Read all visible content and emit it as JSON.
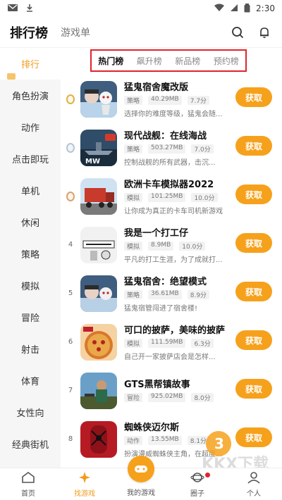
{
  "statusbar": {
    "time": "2:30"
  },
  "header": {
    "title": "排行榜",
    "subtab": "游戏单"
  },
  "sidebar": {
    "items": [
      "排行",
      "角色扮演",
      "动作",
      "点击即玩",
      "单机",
      "休闲",
      "策略",
      "模拟",
      "冒险",
      "射击",
      "体育",
      "女性向",
      "经典街机"
    ]
  },
  "rank_tabs": [
    "热门榜",
    "飙升榜",
    "新品榜",
    "预约榜"
  ],
  "get_label": "获取",
  "apps": [
    {
      "rank": "1",
      "name": "猛鬼宿舍魔改版",
      "meta": [
        "策略",
        "40.29MB",
        "7.7分"
      ],
      "desc": "选择你的难度等级，猛鬼会随..."
    },
    {
      "rank": "2",
      "name": "现代战舰：在线海战",
      "meta": [
        "策略",
        "503.27MB",
        "7.0分"
      ],
      "desc": "控制战舰的所有武器，击沉..."
    },
    {
      "rank": "3",
      "name": "欧洲卡车模拟器2022",
      "meta": [
        "模拟",
        "101.25MB",
        "10.0分"
      ],
      "desc": "让你成为真正的卡车司机新游戏"
    },
    {
      "rank": "4",
      "name": "我是一个打工仔",
      "meta": [
        "模拟",
        "8.9MB",
        "10.0分"
      ],
      "desc": "平凡的打工生涯，为了成就打..."
    },
    {
      "rank": "5",
      "name": "猛鬼宿舍：绝望模式",
      "meta": [
        "策略",
        "36.61MB",
        "8.9分"
      ],
      "desc": "猛鬼宿管闯进了宿舍楼!"
    },
    {
      "rank": "6",
      "name": "可口的披萨，美味的披萨",
      "meta": [
        "模拟",
        "111.59MB",
        "6.3分"
      ],
      "desc": "自己开一家披萨店会是怎样..."
    },
    {
      "rank": "7",
      "name": "GTS黑帮镇故事",
      "meta": [
        "冒险",
        "925.02MB",
        "8.0分"
      ],
      "desc": ""
    },
    {
      "rank": "8",
      "name": "蜘蛛侠迈尔斯",
      "meta": [
        "动作",
        "13.55MB",
        "8.1分"
      ],
      "desc": "扮演漫威蜘蛛侠主角，在超度..."
    }
  ],
  "bottom_nav": [
    "首页",
    "找游戏",
    "我的游戏",
    "圈子",
    "个人"
  ],
  "watermark": {
    "text": "KKX下载",
    "url": "www.kkx.net"
  },
  "colors": {
    "accent": "#f6a11c",
    "highlight_border": "#e0242c"
  }
}
